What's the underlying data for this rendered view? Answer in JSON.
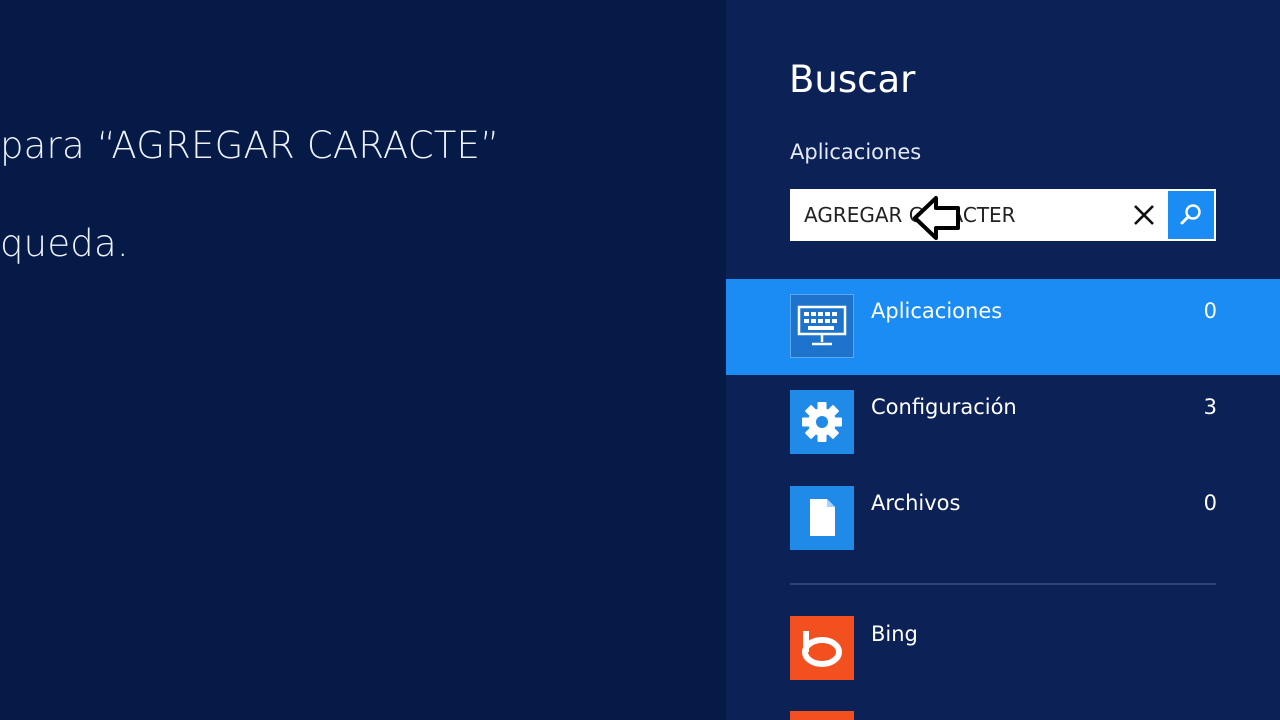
{
  "results_area": {
    "line1": "para “AGREGAR CARACTE”",
    "line2": "queda."
  },
  "search_pane": {
    "title": "Buscar",
    "scope": "Aplicaciones",
    "query": "AGREGAR CARACTER",
    "items": [
      {
        "name": "Aplicaciones",
        "count": "0",
        "icon": "keyboard-icon",
        "selected": true
      },
      {
        "name": "Configuración",
        "count": "3",
        "icon": "gear-icon",
        "selected": false
      },
      {
        "name": "Archivos",
        "count": "0",
        "icon": "document-icon",
        "selected": false
      }
    ],
    "apps": [
      {
        "name": "Bing",
        "icon": "bing-icon"
      }
    ]
  },
  "colors": {
    "background": "#061a48",
    "pane": "#0c2155",
    "accent": "#1b8cf3",
    "bing": "#f2501f"
  }
}
